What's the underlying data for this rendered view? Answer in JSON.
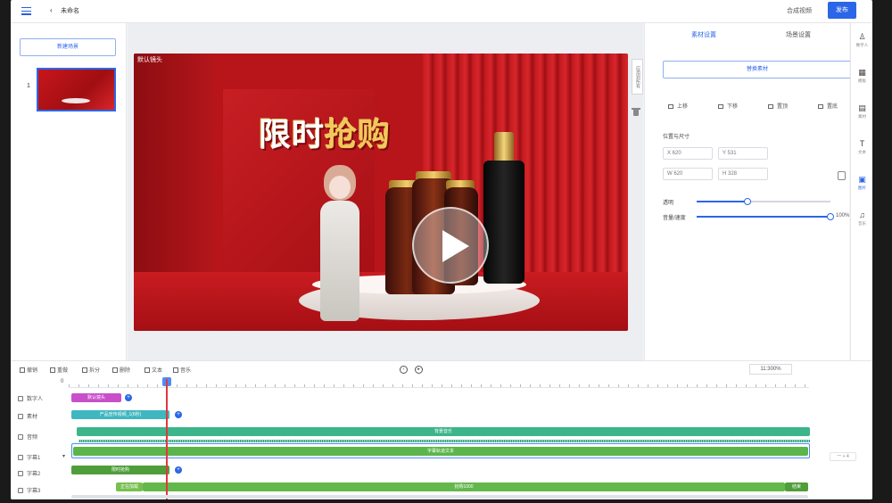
{
  "topbar": {
    "back_label": "未命名",
    "preview_label": "合成视频",
    "publish_label": "发布"
  },
  "left": {
    "new_scene_label": "新建场景",
    "scene_index": "1"
  },
  "stage": {
    "camera_label": "默认镜头",
    "headline_white": "限时",
    "headline_gold": "抢购",
    "side_tab_label": "应用到所有"
  },
  "right": {
    "tabs": [
      "素材设置",
      "场景设置"
    ],
    "replace_label": "替换素材",
    "align": [
      "上移",
      "下移",
      "置顶",
      "置底"
    ],
    "size_section_label": "位置与尺寸",
    "fields": {
      "x": "X 620",
      "y": "Y 531",
      "w": "W 620",
      "h": "H 328"
    },
    "opacity_label": "透明",
    "opacity_value": 0.38,
    "volume_label": "音量/速度",
    "volume_value": 1.0,
    "volume_text": "100%"
  },
  "toolstrip": [
    {
      "icon": "person-icon",
      "glyph": "♙",
      "label": "数字人"
    },
    {
      "icon": "template-icon",
      "glyph": "▦",
      "label": "模板"
    },
    {
      "icon": "material-icon",
      "glyph": "▤",
      "label": "素材"
    },
    {
      "icon": "text-icon",
      "glyph": "T",
      "label": "文本"
    },
    {
      "icon": "image-icon",
      "glyph": "▣",
      "label": "图片",
      "active": true
    },
    {
      "icon": "music-icon",
      "glyph": "♫",
      "label": "音乐"
    }
  ],
  "timeline": {
    "tools": [
      "撤销",
      "重做",
      "拆分",
      "删除",
      "文本",
      "音乐"
    ],
    "zoom_label": "11:300%",
    "ruler_zero": "0",
    "side_ctrl": "一 + 4",
    "tracks": [
      {
        "name": "数字人"
      },
      {
        "name": "素材"
      },
      {
        "name": "音频"
      },
      {
        "name": "字幕1"
      },
      {
        "name": "字幕2"
      },
      {
        "name": "字幕3"
      }
    ],
    "clips": {
      "avatar": "默认镜头",
      "material": "产品宣传视频_1(6秒)",
      "audio": "背景音乐",
      "subtitle1": "字幕轨道文本",
      "subtitle2": "限时抢购",
      "subtitle3_start": "正在加载",
      "subtitle3_mid": "抢购1000",
      "subtitle3_end": "结束"
    }
  }
}
